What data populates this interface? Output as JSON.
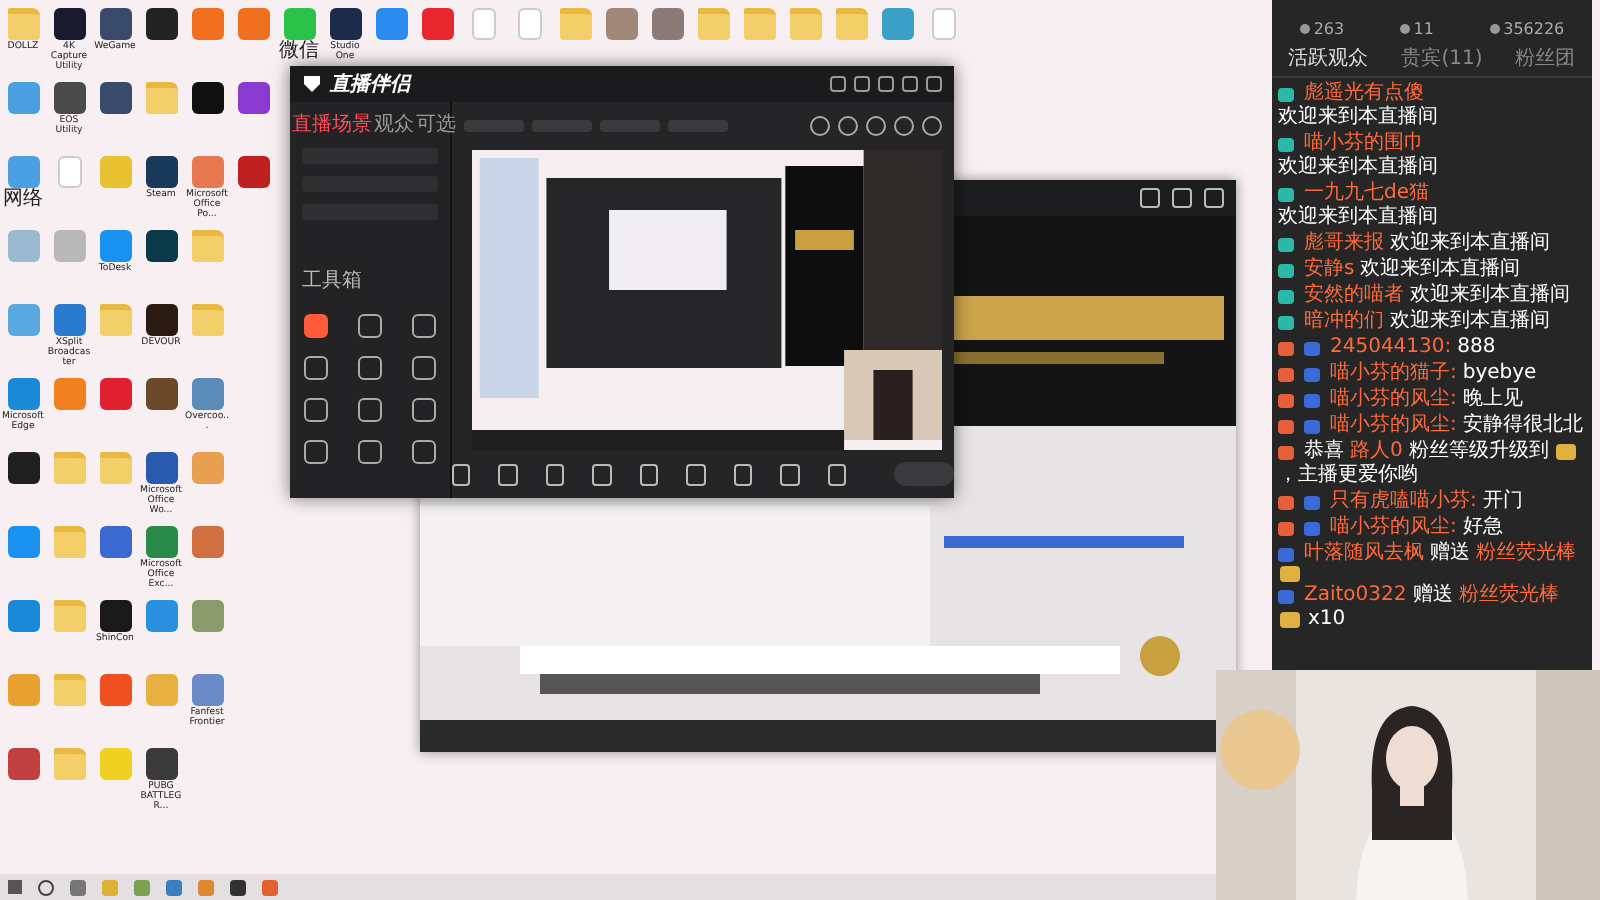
{
  "top_icons": [
    {
      "kind": "folder",
      "label": "DOLLZ"
    },
    {
      "kind": "app",
      "color": "#1a1a2e",
      "label": "4K Capture Utility"
    },
    {
      "kind": "app",
      "color": "#3a4a6a",
      "label": "WeGame"
    },
    {
      "kind": "app",
      "color": "#222222"
    },
    {
      "kind": "app",
      "color": "#f07020"
    },
    {
      "kind": "app",
      "color": "#f07020"
    },
    {
      "kind": "app",
      "color": "#2bc24a",
      "label": "微信"
    },
    {
      "kind": "app",
      "color": "#1c2b4a",
      "label": "Studio One"
    },
    {
      "kind": "app",
      "color": "#2a8cf0"
    },
    {
      "kind": "app",
      "color": "#e8282e"
    },
    {
      "kind": "doc"
    },
    {
      "kind": "doc"
    },
    {
      "kind": "folder"
    },
    {
      "kind": "app",
      "color": "#a08878"
    },
    {
      "kind": "app",
      "color": "#8a7a78"
    },
    {
      "kind": "folder"
    },
    {
      "kind": "folder"
    },
    {
      "kind": "folder"
    },
    {
      "kind": "folder"
    },
    {
      "kind": "app",
      "color": "#3aa0c8"
    },
    {
      "kind": "doc"
    }
  ],
  "icon_rows": [
    [
      {
        "kind": "app",
        "color": "#4aa0e0"
      },
      {
        "kind": "app",
        "color": "#4a4a4a",
        "label": "EOS Utility"
      },
      {
        "kind": "app",
        "color": "#3a4a6a"
      },
      {
        "kind": "folder"
      },
      {
        "kind": "app",
        "color": "#111111"
      },
      {
        "kind": "app",
        "color": "#8a3ad0"
      }
    ],
    [
      {
        "kind": "app",
        "color": "#4aa0e0",
        "label": "网络"
      },
      {
        "kind": "doc"
      },
      {
        "kind": "app",
        "color": "#e8c030"
      },
      {
        "kind": "app",
        "color": "#1a3a5a",
        "label": "Steam"
      },
      {
        "kind": "app",
        "color": "#e87850",
        "label": "Microsoft Office Po..."
      },
      {
        "kind": "app",
        "color": "#c02020"
      }
    ],
    [
      {
        "kind": "app",
        "color": "#9ab8d0"
      },
      {
        "kind": "app",
        "color": "#b8b8b8"
      },
      {
        "kind": "app",
        "color": "#1a90f0",
        "label": "ToDesk"
      },
      {
        "kind": "app",
        "color": "#0a3a4a"
      },
      {
        "kind": "folder"
      }
    ],
    [
      {
        "kind": "app",
        "color": "#5aa8e0"
      },
      {
        "kind": "app",
        "color": "#2a7ad0",
        "label": "XSplit Broadcaster"
      },
      {
        "kind": "folder"
      },
      {
        "kind": "app",
        "color": "#2a1a10",
        "label": "DEVOUR"
      },
      {
        "kind": "folder"
      }
    ],
    [
      {
        "kind": "app",
        "color": "#1a8ad8",
        "label": "Microsoft Edge"
      },
      {
        "kind": "app",
        "color": "#f08020"
      },
      {
        "kind": "app",
        "color": "#e02030"
      },
      {
        "kind": "app",
        "color": "#6a4a2a"
      },
      {
        "kind": "app",
        "color": "#5a8ab8",
        "label": "Overcoo..."
      }
    ],
    [
      {
        "kind": "app",
        "color": "#202020"
      },
      {
        "kind": "folder"
      },
      {
        "kind": "folder"
      },
      {
        "kind": "app",
        "color": "#2a5ab0",
        "label": "Microsoft Office Wo..."
      },
      {
        "kind": "app",
        "color": "#e8a050"
      }
    ],
    [
      {
        "kind": "app",
        "color": "#1a90f0"
      },
      {
        "kind": "folder"
      },
      {
        "kind": "app",
        "color": "#3a6ad0"
      },
      {
        "kind": "app",
        "color": "#2a8a4a",
        "label": "Microsoft Office Exc..."
      },
      {
        "kind": "app",
        "color": "#d07040"
      }
    ],
    [
      {
        "kind": "app",
        "color": "#1a8ad8"
      },
      {
        "kind": "folder"
      },
      {
        "kind": "app",
        "color": "#1a1a1a",
        "label": "ShinCon"
      },
      {
        "kind": "app",
        "color": "#2a90e0"
      },
      {
        "kind": "app",
        "color": "#8a9a6a"
      }
    ],
    [
      {
        "kind": "app",
        "color": "#e8a030"
      },
      {
        "kind": "folder"
      },
      {
        "kind": "app",
        "color": "#f05020"
      },
      {
        "kind": "app",
        "color": "#e8b040"
      },
      {
        "kind": "app",
        "color": "#6a8ac8",
        "label": "Fanfest Frontier"
      }
    ],
    [
      {
        "kind": "app",
        "color": "#c04040"
      },
      {
        "kind": "folder"
      },
      {
        "kind": "app",
        "color": "#f0d020"
      },
      {
        "kind": "app",
        "color": "#3a3a3a",
        "label": "PUBG BATTLEGR..."
      }
    ]
  ],
  "live_window": {
    "title": "直播伴侣",
    "tabs": [
      {
        "label": "直播场景",
        "selected": true
      },
      {
        "label": "观众",
        "selected": false
      },
      {
        "label": "可选",
        "selected": false
      }
    ],
    "toolbox": "工具箱"
  },
  "chat": {
    "stats": [
      "263",
      "11",
      "356226"
    ],
    "tabs": [
      {
        "label": "活跃观众",
        "selected": true
      },
      {
        "label": "贵宾(11)",
        "selected": false
      },
      {
        "label": "粉丝团",
        "selected": false
      }
    ],
    "messages": [
      {
        "kind": "welcome",
        "user": "彪遥光有点傻",
        "text": "欢迎来到本直播间"
      },
      {
        "kind": "welcome",
        "user": "喵小芬的围巾",
        "text": "欢迎来到本直播间"
      },
      {
        "kind": "welcome",
        "user": "一九九七de猫",
        "text": "欢迎来到本直播间"
      },
      {
        "kind": "welcome",
        "user": "彪哥来报",
        "text": "欢迎来到本直播间"
      },
      {
        "kind": "welcome",
        "user": "安静s",
        "text": "欢迎来到本直播间"
      },
      {
        "kind": "welcome",
        "user": "安然的喵者",
        "text": "欢迎来到本直播间"
      },
      {
        "kind": "welcome",
        "user": "暗冲的们",
        "text": "欢迎来到本直播间"
      },
      {
        "kind": "chat",
        "user": "245044130:",
        "text": "888"
      },
      {
        "kind": "chat",
        "user": "喵小芬的猫子:",
        "text": "byebye"
      },
      {
        "kind": "chat",
        "user": "喵小芬的风尘:",
        "text": "晚上见"
      },
      {
        "kind": "chat",
        "user": "喵小芬的风尘:",
        "text": "安静得很北北"
      },
      {
        "kind": "levelup",
        "prefix": "恭喜",
        "user": "路人0",
        "text": "粉丝等级升级到",
        "suffix": "，主播更爱你哟"
      },
      {
        "kind": "chat",
        "user": "只有虎嗑喵小芬:",
        "text": "开门"
      },
      {
        "kind": "chat",
        "user": "喵小芬的风尘:",
        "text": "好急"
      },
      {
        "kind": "gift",
        "user": "叶落随风去枫",
        "verb": "赠送",
        "gift": "粉丝荧光棒"
      },
      {
        "kind": "gift",
        "user": "Zaito0322",
        "verb": "赠送",
        "gift": "粉丝荧光棒",
        "count": "x10"
      }
    ]
  }
}
